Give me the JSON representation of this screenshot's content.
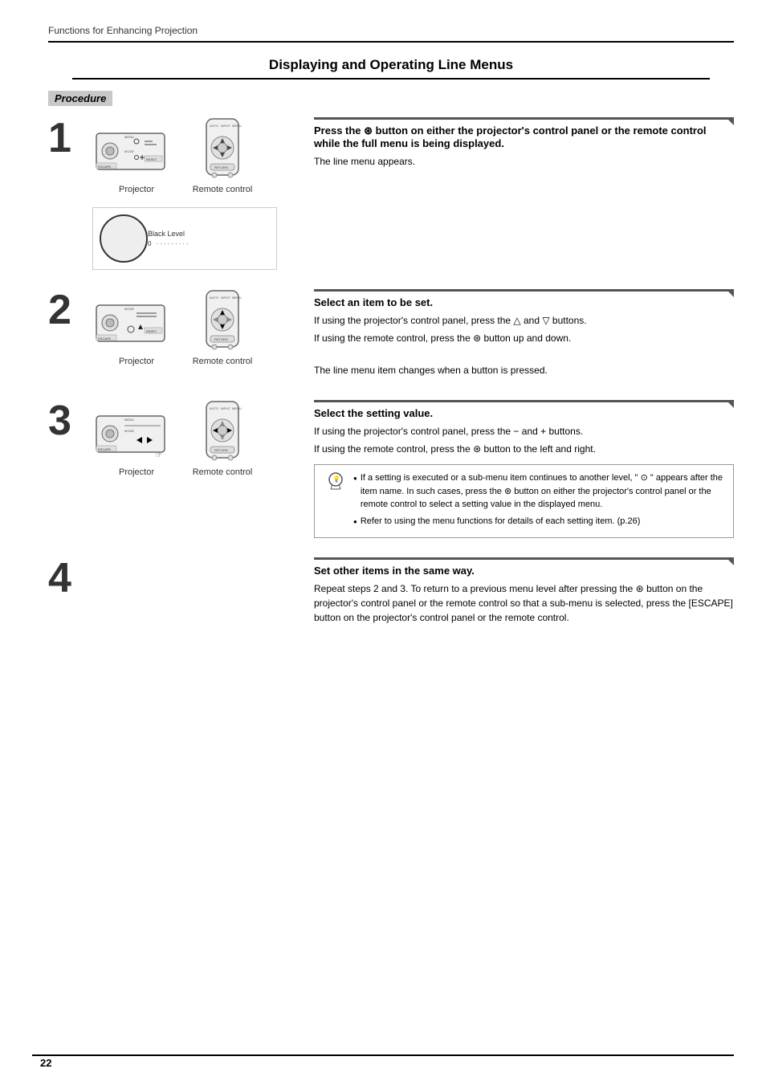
{
  "header": {
    "breadcrumb": "Functions for Enhancing Projection"
  },
  "main_title": "Displaying and Operating Line Menus",
  "procedure_label": "Procedure",
  "steps": [
    {
      "number": "1",
      "caption_projector": "Projector",
      "caption_remote": "Remote control",
      "title": "Press the ⊛ button on either the projector's control panel or the remote control while the full menu is being displayed.",
      "body": "The line menu appears.",
      "extra_note": null
    },
    {
      "number": "2",
      "caption_projector": "Projector",
      "caption_remote": "Remote control",
      "title": "Select an item to be set.",
      "body_lines": [
        "If using the projector's control panel, press the △ and ▽ buttons.",
        "If using the remote control, press the ⊛ button up and down.",
        "",
        "The line menu item changes when a button is pressed."
      ],
      "extra_note": null
    },
    {
      "number": "3",
      "caption_projector": "Projector",
      "caption_remote": "Remote control",
      "title": "Select the setting value.",
      "body_lines": [
        "If using the projector's control panel, press the − and + buttons.",
        "If using the remote control, press the ⊛ button to the left and right."
      ],
      "note_bullets": [
        "If a setting is executed or a sub-menu item continues to another level, \" ⊙ \" appears after the item name. In such cases, press the ⊛ button on either the projector's control panel or the remote control to select a setting value in the displayed menu.",
        "Refer to using the menu functions for details of each setting item. (p.26)"
      ]
    },
    {
      "number": "4",
      "title": "Set other items in the same way.",
      "body": "Repeat steps 2 and 3. To return to a previous menu level after pressing the ⊛ button on the projector's control panel or the remote control so that a sub-menu is selected, press the [ESCAPE] button on the projector's control panel or the remote control."
    }
  ],
  "page_number": "22"
}
